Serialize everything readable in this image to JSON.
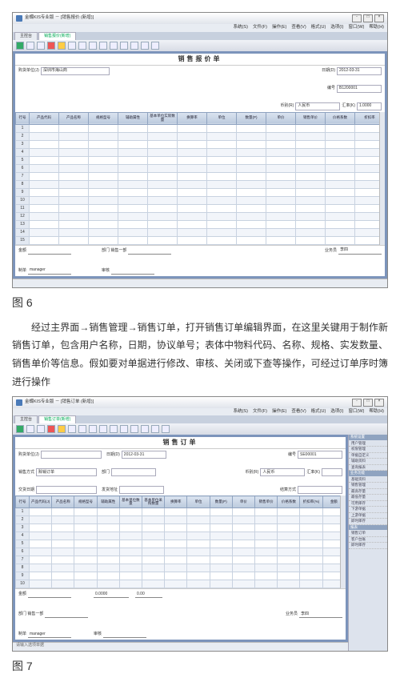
{
  "app1": {
    "title": "金蝶KIS专业版 － [销售报价 (新增)]",
    "menu": [
      "系统(S)",
      "文件(F)",
      "操作(E)",
      "查看(V)",
      "格式(U)",
      "选项(I)",
      "窗口(W)",
      "帮助(H)"
    ],
    "tabs": [
      "主控台",
      "销售报价(新增)"
    ],
    "docTitle": "销售报价单",
    "hdr": {
      "custLbl": "购货单位(J)",
      "custVal": "深圳市海山商",
      "dateLbl": "日期(D)",
      "dateVal": "2012-03-31",
      "noLbl": "编号",
      "noVal": "B1200001",
      "curLbl": "币别(R)",
      "curVal": "人民币",
      "rateLbl": "汇率(K)",
      "rateVal": "1.0000"
    },
    "cols": [
      "行号",
      "产品代码",
      "产品名称",
      "规格型号",
      "辅助属性",
      "基本单位实际数量",
      "换算率",
      "单位",
      "数量(P)",
      "单价",
      "销售单价",
      "价格系数",
      "折扣率"
    ],
    "rows": 15,
    "ftr": {
      "totLbl": "金额",
      "totBox": "",
      "deptLbl": "部门 销售一部",
      "emp": "",
      "makerLbl": "制单",
      "makerVal": "manager",
      "chkLbl": "审核",
      "chkVal": "",
      "salesLbl": "业务员",
      "salesVal": "李四"
    }
  },
  "para": "经过主界面→销售管理→销售订单，打开销售订单编辑界面，在这里关键用于制作新销售订单，包含用户名称，日期，协议单号；表体中物料代码、名称、规格、实发数量、销售单价等信息。假如要对单据进行修改、审核、关闭或下查等操作，可经过订单序时簿进行操作",
  "caption1": "图 6",
  "caption2": "图 7",
  "app2": {
    "title": "金蝶KIS专业版 － [销售订单 (新增)]",
    "menu": [
      "系统(S)",
      "文件(F)",
      "操作(E)",
      "查看(V)",
      "格式(U)",
      "选项(I)",
      "窗口(W)",
      "帮助(H)"
    ],
    "tabs": [
      "主控台",
      "销售订单(新增)"
    ],
    "docTitle": "销售订单",
    "hdr": {
      "custLbl": "购货单位(J)",
      "custVal": "",
      "dateLbl": "日期(D)",
      "dateVal": "2012-03-31",
      "noLbl": "编号",
      "noVal": "SE00001",
      "agrLbl": "销售方式",
      "agrVal": "赊销订单",
      "deptLbl": "部门",
      "deptVal": "",
      "curLbl": "币别(R)",
      "curVal": "人民币",
      "rateLbl": "汇率(K)",
      "rateVal": "",
      "delLbl": "交货日期",
      "delVal": "",
      "fetLbl": "发货地址",
      "fetVal": "",
      "payLbl": "结算方式",
      "payVal": ""
    },
    "cols": [
      "行号",
      "产品代码(J)",
      "产品名称",
      "规格型号",
      "辅助属性",
      "基本单位数量",
      "基本单位采购数量",
      "换算率",
      "单位",
      "数量(P)",
      "单价",
      "销售单价",
      "价格系数",
      "折扣率(%)",
      "金额"
    ],
    "rows": 10,
    "ftr": {
      "totLbl": "金额",
      "totVal": "0.0000",
      "totVal2": "0.00",
      "deptLbl": "部门 销售一部",
      "emp": "",
      "makerLbl": "制单",
      "makerVal": "manager",
      "chkLbl": "审核",
      "chkVal": "",
      "salesLbl": "业务员",
      "salesVal": "李四"
    },
    "side": {
      "h1": "系统设置",
      "i1": [
        "用户管理",
        "权限管理",
        "单据自定义",
        "辅助资料",
        "查询报表"
      ],
      "h2": "业务功能",
      "i2": [
        "基础资料",
        "销售管理",
        "最高存量",
        "最低存量",
        "可用库存",
        "下游单据",
        "上游单据",
        "即时库存"
      ],
      "h3": "报表",
      "i3": [
        "销售订单",
        "客户台账",
        "即时库存"
      ]
    },
    "stat": "请输入选项单据"
  }
}
